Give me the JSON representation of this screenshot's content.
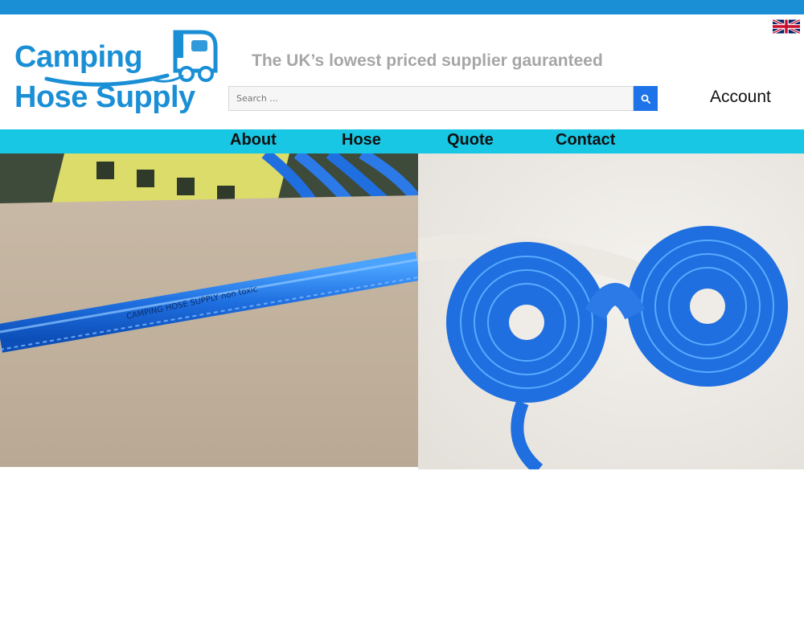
{
  "header": {
    "logo": {
      "line1": "Camping",
      "line2": "Hose Supply"
    },
    "tagline": "The UK’s lowest priced supplier gauranteed",
    "search": {
      "placeholder": "Search ...",
      "value": ""
    },
    "account_label": "Account",
    "language_flag": "uk-flag-icon"
  },
  "nav": {
    "items": [
      {
        "label": "About"
      },
      {
        "label": "Hose"
      },
      {
        "label": "Quote"
      },
      {
        "label": "Contact"
      }
    ]
  },
  "gallery": {
    "left_photo": {
      "hose_print": "CAMPING HOSE SUPPLY non toxic"
    },
    "right_photo": {}
  },
  "colors": {
    "top_bar": "#1a8fd6",
    "brand_blue": "#1a8fd6",
    "nav_bar": "#18c7e4",
    "search_button": "#1e73e8",
    "hose_blue": "#1f6fe0"
  }
}
